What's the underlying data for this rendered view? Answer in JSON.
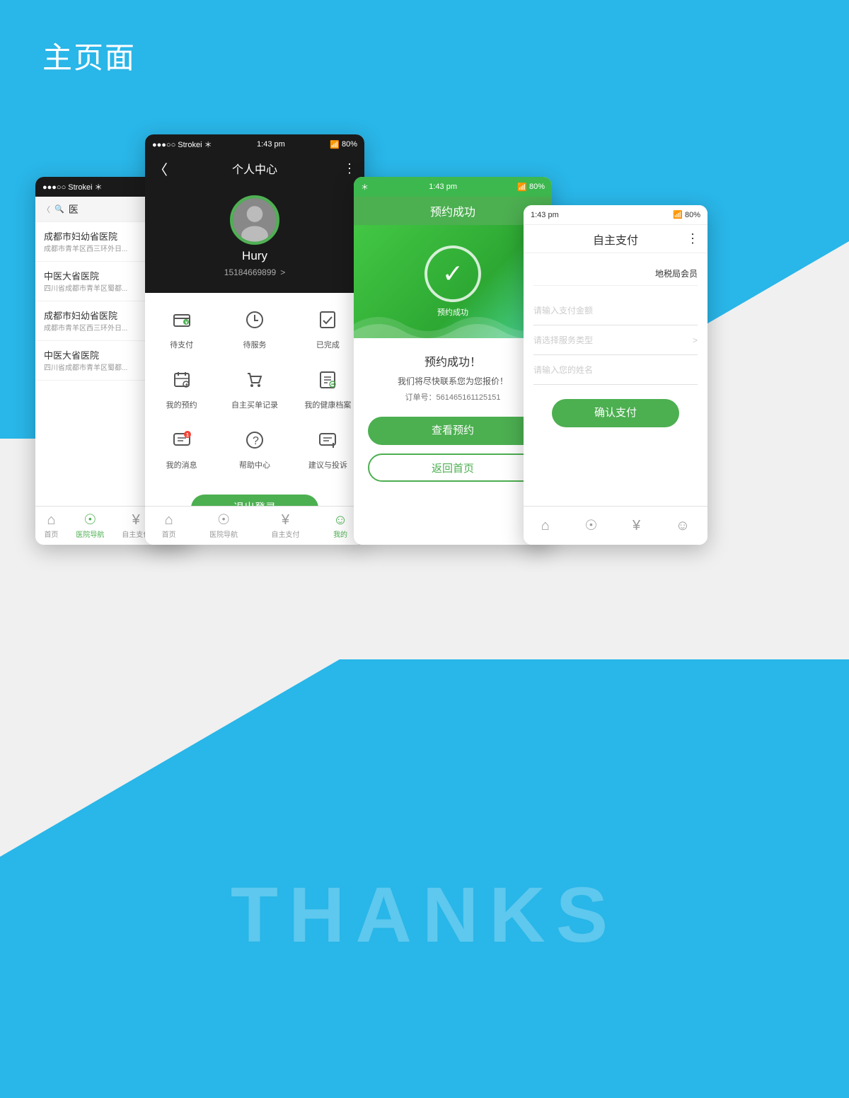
{
  "page": {
    "title": "主页面",
    "thanks": "THANKS"
  },
  "screen1": {
    "status_left": "●●●○○ Strokei ＊",
    "nav_title": "",
    "back": "〈",
    "search_icon": "🔍",
    "search_placeholder": "医",
    "items": [
      {
        "name": "成都市妇幼省医院",
        "addr": "成都市青羊区西三环外日..."
      },
      {
        "name": "中医大省医院",
        "addr": "四川省成都市青羊区蜀都..."
      },
      {
        "name": "成都市妇幼省医院",
        "addr": "成都市青羊区西三环外日..."
      },
      {
        "name": "中医大省医院",
        "addr": "四川省成都市青羊区蜀都..."
      }
    ],
    "tabs": [
      {
        "icon": "⌂",
        "label": "首页",
        "active": false
      },
      {
        "icon": "☉",
        "label": "医院导航",
        "active": true
      }
    ]
  },
  "screen2": {
    "status_left": "●●●○○ Strokei ＊",
    "status_time": "1:43 pm",
    "status_battery": "80%",
    "nav_title": "个人中心",
    "back": "〈",
    "more": "⋮",
    "avatar_emoji": "👤",
    "user_name": "Hury",
    "user_phone": "15184669899",
    "arrow": ">",
    "grid_items": [
      {
        "icon": "💳",
        "label": "待支付",
        "badge": false
      },
      {
        "icon": "⏰",
        "label": "待服务",
        "badge": false
      },
      {
        "icon": "📋",
        "label": "已完成",
        "badge": false
      },
      {
        "icon": "📅",
        "label": "我的预约",
        "badge": false
      },
      {
        "icon": "🛒",
        "label": "自主买单记录",
        "badge": false
      },
      {
        "icon": "📂",
        "label": "我的健康档案",
        "badge": false
      },
      {
        "icon": "💬",
        "label": "我的消息",
        "badge": true,
        "badge_count": "1"
      },
      {
        "icon": "❓",
        "label": "帮助中心",
        "badge": false
      },
      {
        "icon": "📝",
        "label": "建议与投诉",
        "badge": false
      }
    ],
    "logout_label": "退出登录",
    "tabs": [
      {
        "icon": "⌂",
        "label": "首页",
        "active": false
      },
      {
        "icon": "☉",
        "label": "医院导航",
        "active": false
      },
      {
        "icon": "¥",
        "label": "自主支付",
        "active": false
      },
      {
        "icon": "☺",
        "label": "我的",
        "active": true
      }
    ]
  },
  "screen3": {
    "status_left": "＊",
    "status_time": "1:43 pm",
    "status_battery": "80%",
    "nav_title": "预约成功",
    "more": "⋮",
    "check_label": "预约成功",
    "success_title": "预约成功！",
    "success_subtitle": "我们将尽快联系您为您报价！",
    "order_no": "订单号：561465161125151",
    "btn_view": "查看预约",
    "btn_home": "返回首页"
  },
  "screen4": {
    "status_time": "1:43 pm",
    "status_battery": "80%",
    "nav_title": "自主支付",
    "more": "⋮",
    "member_label": "地税局会员",
    "field1_placeholder": "请输入支付金额",
    "field2_placeholder": "请选择服务类型",
    "field2_arrow": ">",
    "field3_placeholder": "请输入您的姓名",
    "confirm_label": "确认支付",
    "tabs": [
      {
        "icon": "⌂",
        "label": "",
        "active": false
      },
      {
        "icon": "☉",
        "label": "",
        "active": false
      },
      {
        "icon": "¥",
        "label": "",
        "active": false
      },
      {
        "icon": "☺",
        "label": "",
        "active": false
      }
    ]
  }
}
